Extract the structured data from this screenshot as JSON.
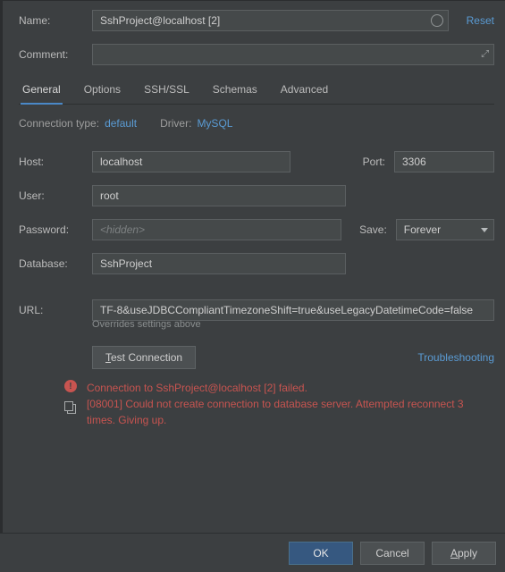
{
  "header": {
    "name_label": "Name:",
    "name_value": "SshProject@localhost [2]",
    "reset": "Reset",
    "comment_label": "Comment:",
    "comment_value": ""
  },
  "tabs": [
    "General",
    "Options",
    "SSH/SSL",
    "Schemas",
    "Advanced"
  ],
  "active_tab": 0,
  "connection": {
    "type_label": "Connection type:",
    "type_value": "default",
    "driver_label": "Driver:",
    "driver_value": "MySQL"
  },
  "fields": {
    "host_label": "Host:",
    "host_value": "localhost",
    "port_label": "Port:",
    "port_value": "3306",
    "user_label": "User:",
    "user_value": "root",
    "password_label": "Password:",
    "password_placeholder": "<hidden>",
    "save_label": "Save:",
    "save_value": "Forever",
    "database_label": "Database:",
    "database_value": "SshProject",
    "url_label": "URL:",
    "url_value": "TF-8&useJDBCCompliantTimezoneShift=true&useLegacyDatetimeCode=false",
    "url_hint": "Overrides settings above"
  },
  "actions": {
    "test_connection_prefix": "T",
    "test_connection_rest": "est Connection",
    "troubleshooting": "Troubleshooting"
  },
  "error": {
    "line1": "Connection to SshProject@localhost [2] failed.",
    "line2": "[08001] Could not create connection to database server. Attempted reconnect 3 times. Giving up."
  },
  "footer": {
    "ok": "OK",
    "cancel": "Cancel",
    "apply": "Apply"
  }
}
